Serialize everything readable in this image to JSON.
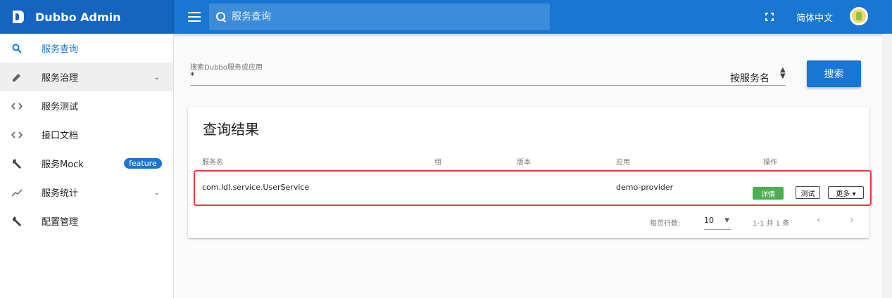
{
  "brand": {
    "title": "Dubbo Admin"
  },
  "header": {
    "search_placeholder": "服务查询",
    "language": "简体中文"
  },
  "sidebar": {
    "items": [
      {
        "label": "服务查询",
        "icon": "search-icon",
        "chevron": ""
      },
      {
        "label": "服务治理",
        "icon": "pencil-icon",
        "chevron": "⌄"
      },
      {
        "label": "服务测试",
        "icon": "code-icon",
        "chevron": ""
      },
      {
        "label": "接口文档",
        "icon": "code-icon",
        "chevron": ""
      },
      {
        "label": "服务Mock",
        "icon": "wrench-icon",
        "badge": "feature"
      },
      {
        "label": "服务统计",
        "icon": "trending-icon",
        "chevron": "⌄"
      },
      {
        "label": "配置管理",
        "icon": "wrench-icon",
        "chevron": ""
      }
    ]
  },
  "search": {
    "label": "搜索Dubbo服务或应用",
    "value": "*",
    "type": "按服务名",
    "button": "搜索"
  },
  "results": {
    "title": "查询结果",
    "columns": [
      "服务名",
      "组",
      "版本",
      "应用",
      "操作"
    ],
    "rows": [
      {
        "service": "com.ldl.service.UserService",
        "group": "",
        "version": "",
        "application": "demo-provider",
        "actions": {
          "detail": "详情",
          "test": "测试",
          "more": "更多 ▾"
        }
      }
    ],
    "footer": {
      "rows_per_page_label": "每页行数:",
      "rows_per_page": "10",
      "range": "1-1 共 1 条",
      "prev": "‹",
      "next": "›"
    }
  },
  "colors": {
    "primary": "#1976d2",
    "brand_bg": "#1565c0",
    "success": "#4caf50",
    "highlight": "#e53935"
  }
}
